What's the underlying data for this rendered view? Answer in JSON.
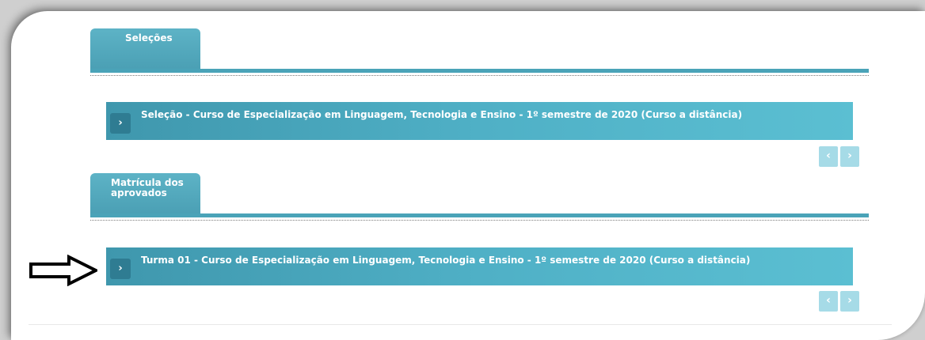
{
  "sections": [
    {
      "tab_label": "Seleções",
      "items": [
        {
          "text": "Seleção - Curso de Especialização em Linguagem, Tecnologia e Ensino - 1º semestre de 2020 (Curso a distância)",
          "button_glyph": "›"
        }
      ],
      "pager": {
        "prev": "‹",
        "next": "›"
      }
    },
    {
      "tab_label": "Matrícula dos aprovados",
      "items": [
        {
          "text": "Turma 01 - Curso de Especialização em Linguagem, Tecnologia e Ensino - 1º semestre de 2020 (Curso a distância)",
          "button_glyph": "›"
        }
      ],
      "pager": {
        "prev": "‹",
        "next": "›"
      }
    }
  ],
  "annotation": {
    "icon": "right-arrow-icon"
  },
  "colors": {
    "accent": "#4aa3b8",
    "row_dark": "#3f97ad",
    "row_light": "#5bbfd2",
    "pager": "#a6dbe7"
  }
}
